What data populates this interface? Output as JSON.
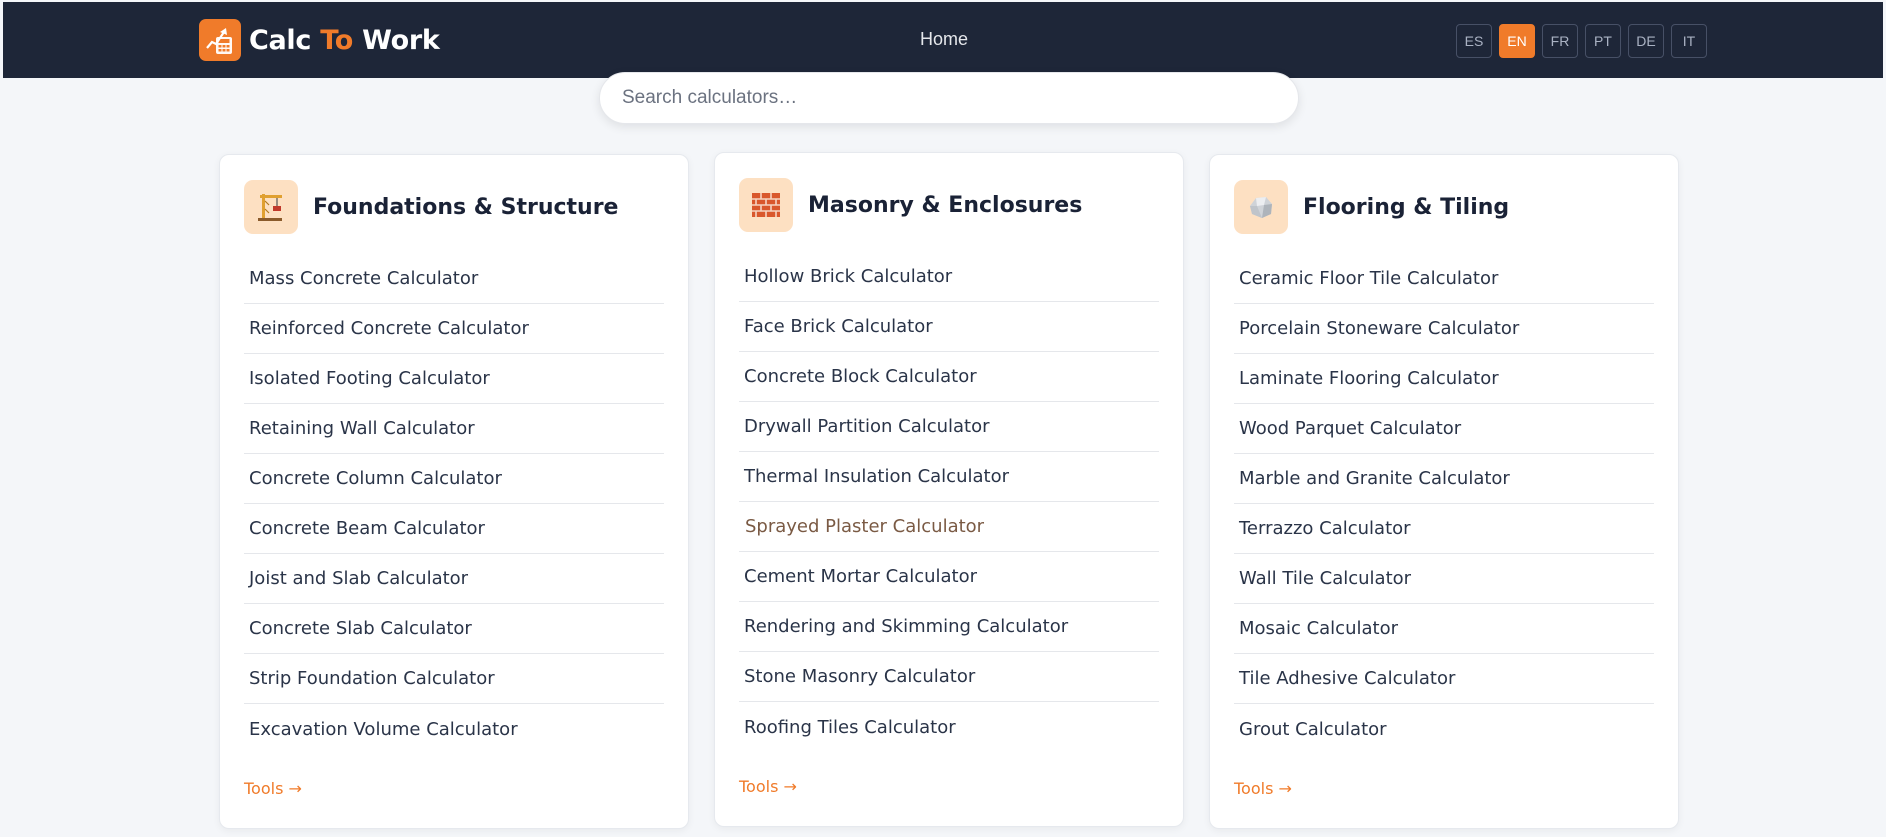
{
  "header": {
    "brand": {
      "part1": "Calc ",
      "part2": "To",
      "part3": " Work"
    },
    "nav": {
      "home": "Home"
    },
    "languages": [
      {
        "code": "ES",
        "active": false
      },
      {
        "code": "EN",
        "active": true
      },
      {
        "code": "FR",
        "active": false
      },
      {
        "code": "PT",
        "active": false
      },
      {
        "code": "DE",
        "active": false
      },
      {
        "code": "IT",
        "active": false
      }
    ]
  },
  "search": {
    "placeholder": "Search calculators…"
  },
  "categories": [
    {
      "title": "Foundations & Structure",
      "icon": "crane-icon",
      "items": [
        "Mass Concrete Calculator",
        "Reinforced Concrete Calculator",
        "Isolated Footing Calculator",
        "Retaining Wall Calculator",
        "Concrete Column Calculator",
        "Concrete Beam Calculator",
        "Joist and Slab Calculator",
        "Concrete Slab Calculator",
        "Strip Foundation Calculator",
        "Excavation Volume Calculator"
      ],
      "tools_link": "Tools →"
    },
    {
      "title": "Masonry & Enclosures",
      "icon": "brick-icon",
      "items": [
        "Hollow Brick Calculator",
        "Face Brick Calculator",
        "Concrete Block Calculator",
        "Drywall Partition Calculator",
        "Thermal Insulation Calculator",
        "Sprayed Plaster Calculator",
        "Cement Mortar Calculator",
        "Rendering and Skimming Calculator",
        "Stone Masonry Calculator",
        "Roofing Tiles Calculator"
      ],
      "tools_link": "Tools →"
    },
    {
      "title": "Flooring & Tiling",
      "icon": "rock-icon",
      "items": [
        "Ceramic Floor Tile Calculator",
        "Porcelain Stoneware Calculator",
        "Laminate Flooring Calculator",
        "Wood Parquet Calculator",
        "Marble and Granite Calculator",
        "Terrazzo Calculator",
        "Wall Tile Calculator",
        "Mosaic Calculator",
        "Tile Adhesive Calculator",
        "Grout Calculator"
      ],
      "tools_link": "Tools →"
    }
  ],
  "colors": {
    "header_bg": "#1e2638",
    "accent": "#f07b2a",
    "page_bg": "#f4f6f9"
  }
}
